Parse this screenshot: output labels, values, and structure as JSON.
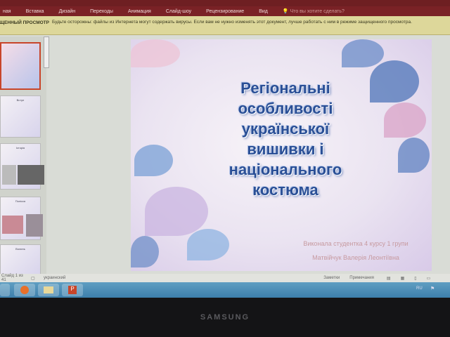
{
  "ribbon": {
    "tabs": [
      "Вставка",
      "Дизайн",
      "Переходы",
      "Анимация",
      "Слайд-шоу",
      "Рецензирование",
      "Вид"
    ],
    "tell_me": "Что вы хотите сделать?"
  },
  "warning": {
    "label": "ЗАЩИЩЕННЫЙ ПРОСМОТР",
    "message": "Будьте осторожны: файлы из Интернета могут содержать вирусы. Если вам не нужно изменять этот документ, лучше работать с ним в режиме защищенного просмотра."
  },
  "thumbnails": [
    {
      "title": ""
    },
    {
      "title": "Вступ"
    },
    {
      "title": "Історія"
    },
    {
      "title": "Полісся"
    },
    {
      "title": "Волинь"
    }
  ],
  "slide": {
    "title_lines": [
      "Регіональні",
      "особливості",
      "української",
      "вишивки і",
      "національного",
      "костюма"
    ],
    "author_line1": "Виконала студентка 4 курсу 1 групи",
    "author_line2": "Матвійчук Валерія Леонтіївна"
  },
  "status": {
    "slide_counter": "Слайд 1 из 41",
    "language": "украинский",
    "notes": "Заметки",
    "comments": "Примечания"
  },
  "taskbar": {
    "lang": "RU"
  },
  "bezel": {
    "brand": "SAMSUNG"
  }
}
